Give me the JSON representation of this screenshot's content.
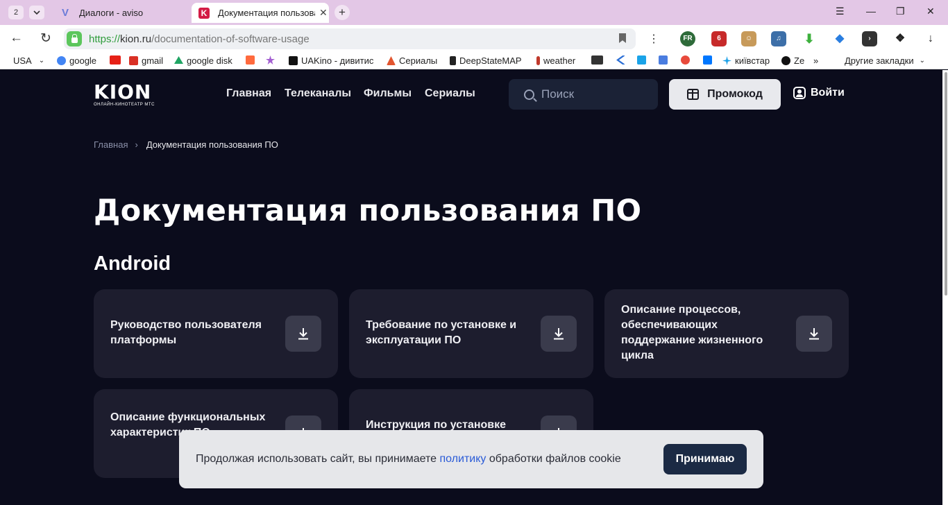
{
  "browser": {
    "tab_count": "2",
    "tabs": [
      {
        "title": "Диалоги - aviso",
        "favicon": "V"
      },
      {
        "title": "Документация пользования ПО",
        "favicon": "K"
      }
    ],
    "url_proto": "https://",
    "url_host": "kion.ru",
    "url_path": "/documentation-of-software-usage",
    "bookmarks": [
      {
        "label": "USA",
        "color": "#ffffff"
      },
      {
        "label": "google",
        "color": "#4285f4"
      },
      {
        "label": "",
        "color": "#e62117"
      },
      {
        "label": "gmail",
        "color": "#d93025"
      },
      {
        "label": "google disk",
        "color": "#1fa463"
      },
      {
        "label": "",
        "color": "#ff6a3d"
      },
      {
        "label": "",
        "color": "#a35fd1"
      },
      {
        "label": "UAKino - дивитис",
        "color": "#111111"
      },
      {
        "label": "Сериалы",
        "color": "#e2552f"
      },
      {
        "label": "DeepStateMAP",
        "color": "#222222"
      },
      {
        "label": "weather",
        "color": "#c0392b"
      },
      {
        "label": "",
        "color": "#333333"
      },
      {
        "label": "",
        "color": "#2b6fd6"
      },
      {
        "label": "",
        "color": "#1aa3e8"
      },
      {
        "label": "",
        "color": "#4a7de0"
      },
      {
        "label": "",
        "color": "#e84a3c"
      },
      {
        "label": "",
        "color": "#0077ff"
      },
      {
        "label": "київстар",
        "color": "#1aa0e8"
      },
      {
        "label": "Ze",
        "color": "#111111"
      }
    ],
    "other_bookmarks": "Другие закладки",
    "more_chevron": "»"
  },
  "site": {
    "logo_word": "KION",
    "logo_tagline": "ОНЛАЙН-КИНОТЕАТР МТС",
    "nav": [
      "Главная",
      "Телеканалы",
      "Фильмы",
      "Сериалы"
    ],
    "search_placeholder": "Поиск",
    "promo_label": "Промокод",
    "login_label": "Войти"
  },
  "breadcrumb": {
    "home": "Главная",
    "current": "Документация пользования ПО"
  },
  "page_title": "Документация пользования ПО",
  "section_title": "Android",
  "documents": [
    "Руководство пользователя платформы",
    "Требование по установке и эксплуатации ПО",
    "Описание процессов, обеспечивающих поддержание жизненного цикла",
    "Описание функциональных характеристик ПО",
    "Инструкция по установке"
  ],
  "cookie": {
    "text_before": "Продолжая использовать сайт, вы принимаете ",
    "link": "политику",
    "text_after": " обработки файлов cookie",
    "accept": "Принимаю"
  },
  "colors": {
    "background": "#0b0c1c",
    "card": "#1d1d2e",
    "accent_link": "#2a5bd7",
    "accept_button": "#1b2a44"
  }
}
